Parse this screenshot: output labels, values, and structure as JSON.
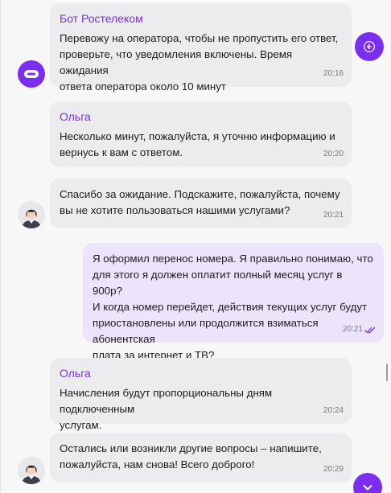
{
  "messages": [
    {
      "author": "Бот Ростелеком",
      "text": "Перевожу на оператора, чтобы не пропустить его ответ,\nпроверьте, что уведомления включены. Время ожидания\nответа оператора около 10 минут",
      "time": "20:16"
    },
    {
      "author": "Ольга",
      "text": "Несколько минут, пожалуйста, я уточню информацию и\nвернусь к вам с ответом.",
      "time": "20:20"
    },
    {
      "author": "",
      "text": "Спасибо за ожидание. Подскажите, пожалуйста, почему\nвы не хотите пользоваться нашими услугами?",
      "time": "20:21"
    },
    {
      "author": "",
      "text": "Я оформил перенос номера. Я правильно понимаю, что\nдля этого я должен оплатит полный месяц услуг в 900р?\nИ когда номер перейдет, действия текущих услуг будут\nприостановлены или продолжится взиматься абонентская\nплата за интернет и ТВ?",
      "time": "20:21",
      "status": "read-double-check"
    },
    {
      "author": "Ольга",
      "text": "Начисления будут пропорциональны дням подключенным\nуслугам.",
      "time": "20:24"
    },
    {
      "author": "",
      "text": "Остались или возникли другие вопросы – напишите,\nпожалуйста, нам снова! Всего доброго!",
      "time": "20:29"
    }
  ],
  "colors": {
    "accent": "#7b2ef0",
    "incoming_bubble": "#ececef",
    "outgoing_bubble": "#ece4fb",
    "read_check": "#7b2ef0"
  },
  "icons": {
    "share": "share-arrow-icon",
    "scroll_down": "chevron-down-icon",
    "bot_avatar": "bot-avatar-icon",
    "operator_avatar": "operator-avatar-icon"
  }
}
